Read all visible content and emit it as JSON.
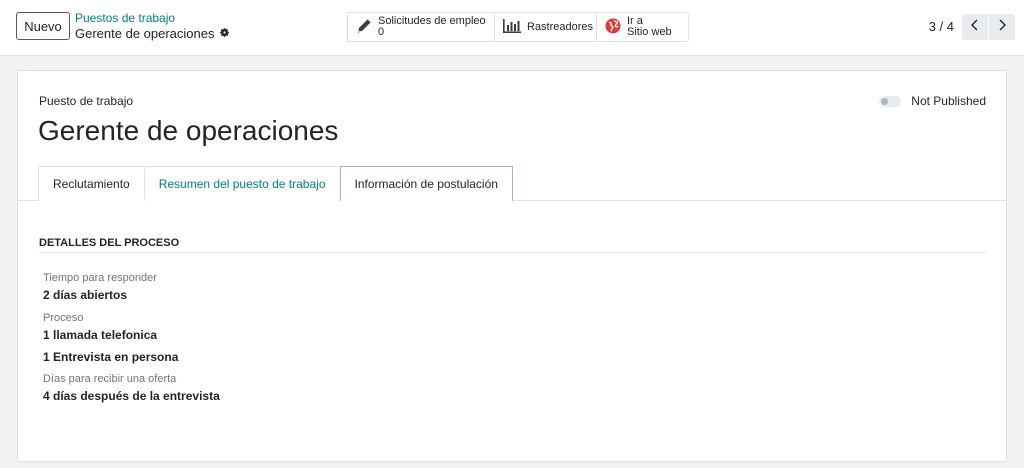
{
  "control_panel": {
    "new_button": "Nuevo",
    "breadcrumb_parent": "Puestos de trabajo",
    "breadcrumb_current": "Gerente de operaciones",
    "stats": {
      "applications_label": "Solicitudes de empleo",
      "applications_count": "0",
      "trackers_label": "Rastreadores",
      "website_line1": "Ir a",
      "website_line2": "Sitio web"
    },
    "pager": "3 / 4"
  },
  "sheet": {
    "small_label": "Puesto de trabajo",
    "title": "Gerente de operaciones",
    "publish_status": "Not Published",
    "tabs": [
      {
        "label": "Reclutamiento"
      },
      {
        "label": "Resumen del puesto de trabajo"
      },
      {
        "label": "Información de postulación"
      }
    ],
    "section": {
      "title": "DETALLES DEL PROCESO",
      "time_label": "Tiempo para responder",
      "time_value": "2 días abiertos",
      "process_label": "Proceso",
      "process_step1": "1 llamada telefonica",
      "process_step2": "1 Entrevista en persona",
      "offer_label": "Días para recibir una oferta",
      "offer_value": "4 días después de la entrevista"
    }
  },
  "colors": {
    "brand": "#714b67",
    "link": "#017e84",
    "website_icon": "#e03a3a"
  },
  "icons": [
    "gear-icon",
    "pencil-icon",
    "bar-chart-icon",
    "globe-icon",
    "chevron-left-icon",
    "chevron-right-icon"
  ]
}
